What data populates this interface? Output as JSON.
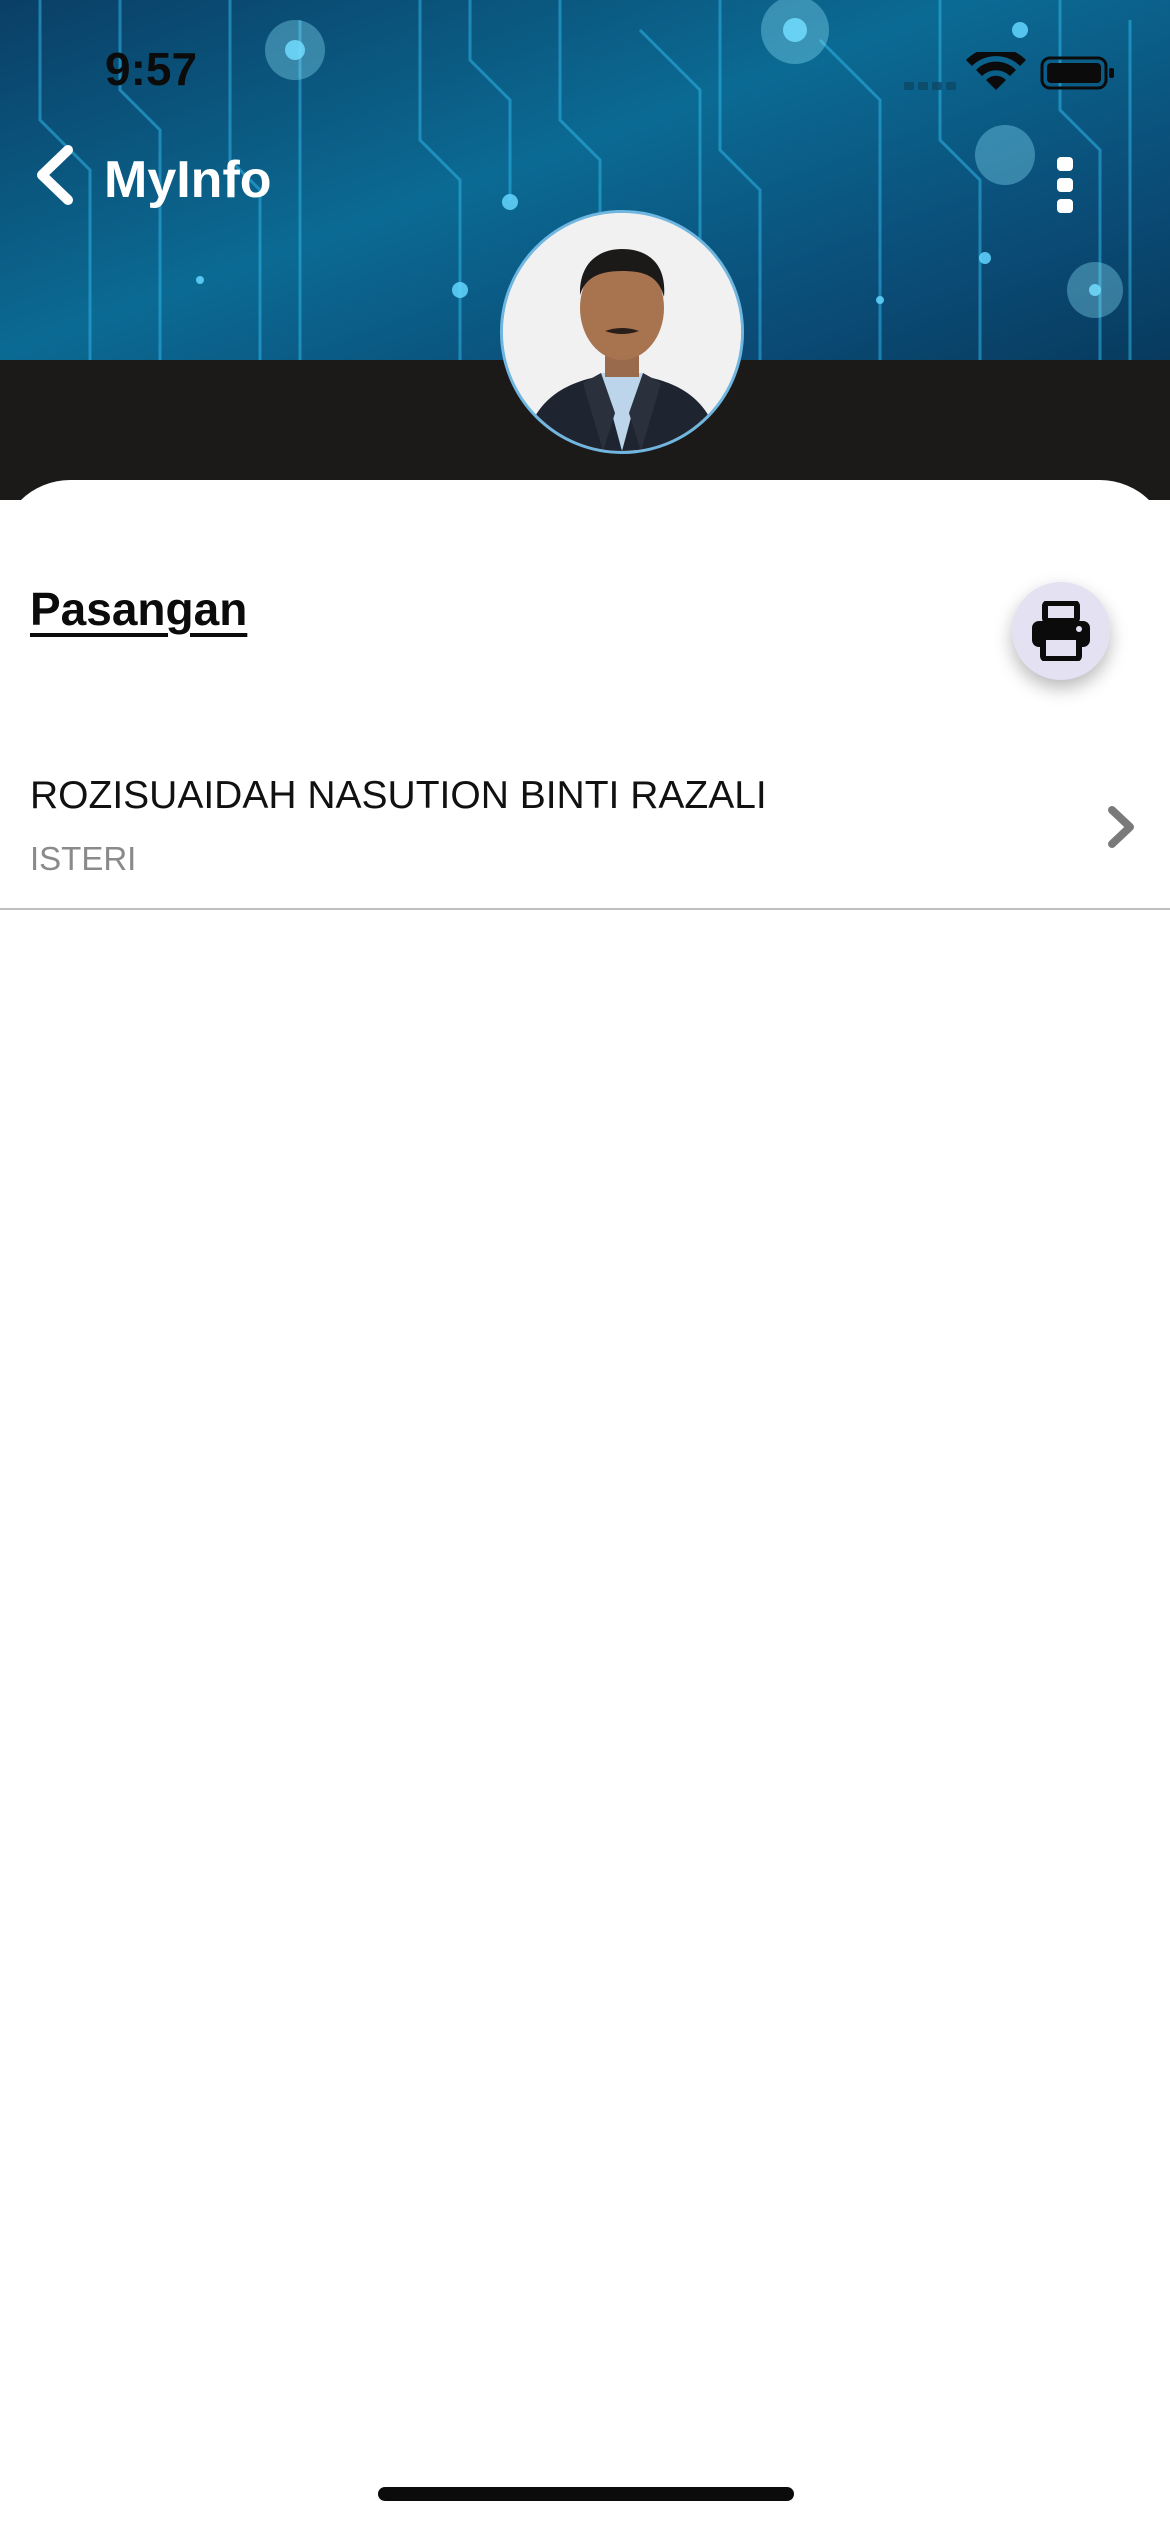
{
  "status_bar": {
    "time": "9:57"
  },
  "nav": {
    "title": "MyInfo",
    "back_icon": "chevron-left-icon",
    "menu_icon": "more-vertical-icon"
  },
  "section": {
    "title": "Pasangan",
    "print_icon": "printer-icon"
  },
  "spouses": [
    {
      "name": "ROZISUAIDAH NASUTION BINTI RAZALI",
      "relation": "ISTERI"
    }
  ],
  "colors": {
    "banner": "#0b6a93",
    "dark_band": "#1c1a19",
    "print_button": "#e4e1f3",
    "accent": "#6fb6e0"
  }
}
